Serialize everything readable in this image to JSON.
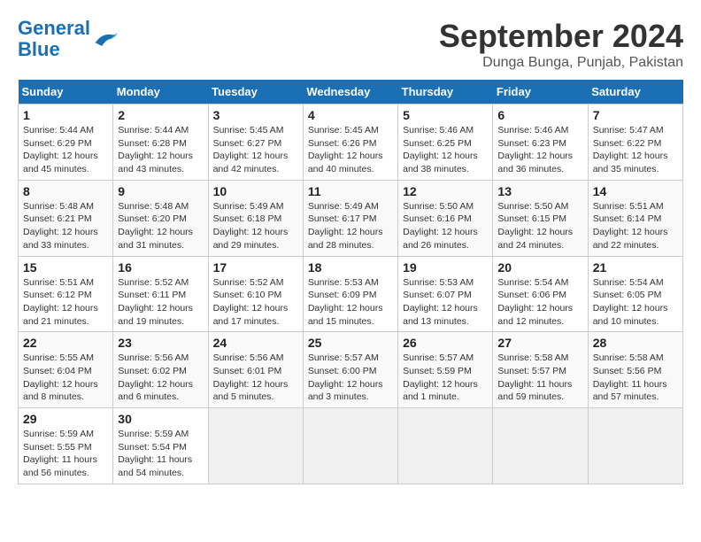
{
  "app": {
    "name": "General",
    "name_blue": "Blue"
  },
  "title": "September 2024",
  "location": "Dunga Bunga, Punjab, Pakistan",
  "weekdays": [
    "Sunday",
    "Monday",
    "Tuesday",
    "Wednesday",
    "Thursday",
    "Friday",
    "Saturday"
  ],
  "weeks": [
    [
      {
        "day": "1",
        "info": "Sunrise: 5:44 AM\nSunset: 6:29 PM\nDaylight: 12 hours\nand 45 minutes."
      },
      {
        "day": "2",
        "info": "Sunrise: 5:44 AM\nSunset: 6:28 PM\nDaylight: 12 hours\nand 43 minutes."
      },
      {
        "day": "3",
        "info": "Sunrise: 5:45 AM\nSunset: 6:27 PM\nDaylight: 12 hours\nand 42 minutes."
      },
      {
        "day": "4",
        "info": "Sunrise: 5:45 AM\nSunset: 6:26 PM\nDaylight: 12 hours\nand 40 minutes."
      },
      {
        "day": "5",
        "info": "Sunrise: 5:46 AM\nSunset: 6:25 PM\nDaylight: 12 hours\nand 38 minutes."
      },
      {
        "day": "6",
        "info": "Sunrise: 5:46 AM\nSunset: 6:23 PM\nDaylight: 12 hours\nand 36 minutes."
      },
      {
        "day": "7",
        "info": "Sunrise: 5:47 AM\nSunset: 6:22 PM\nDaylight: 12 hours\nand 35 minutes."
      }
    ],
    [
      {
        "day": "8",
        "info": "Sunrise: 5:48 AM\nSunset: 6:21 PM\nDaylight: 12 hours\nand 33 minutes."
      },
      {
        "day": "9",
        "info": "Sunrise: 5:48 AM\nSunset: 6:20 PM\nDaylight: 12 hours\nand 31 minutes."
      },
      {
        "day": "10",
        "info": "Sunrise: 5:49 AM\nSunset: 6:18 PM\nDaylight: 12 hours\nand 29 minutes."
      },
      {
        "day": "11",
        "info": "Sunrise: 5:49 AM\nSunset: 6:17 PM\nDaylight: 12 hours\nand 28 minutes."
      },
      {
        "day": "12",
        "info": "Sunrise: 5:50 AM\nSunset: 6:16 PM\nDaylight: 12 hours\nand 26 minutes."
      },
      {
        "day": "13",
        "info": "Sunrise: 5:50 AM\nSunset: 6:15 PM\nDaylight: 12 hours\nand 24 minutes."
      },
      {
        "day": "14",
        "info": "Sunrise: 5:51 AM\nSunset: 6:14 PM\nDaylight: 12 hours\nand 22 minutes."
      }
    ],
    [
      {
        "day": "15",
        "info": "Sunrise: 5:51 AM\nSunset: 6:12 PM\nDaylight: 12 hours\nand 21 minutes."
      },
      {
        "day": "16",
        "info": "Sunrise: 5:52 AM\nSunset: 6:11 PM\nDaylight: 12 hours\nand 19 minutes."
      },
      {
        "day": "17",
        "info": "Sunrise: 5:52 AM\nSunset: 6:10 PM\nDaylight: 12 hours\nand 17 minutes."
      },
      {
        "day": "18",
        "info": "Sunrise: 5:53 AM\nSunset: 6:09 PM\nDaylight: 12 hours\nand 15 minutes."
      },
      {
        "day": "19",
        "info": "Sunrise: 5:53 AM\nSunset: 6:07 PM\nDaylight: 12 hours\nand 13 minutes."
      },
      {
        "day": "20",
        "info": "Sunrise: 5:54 AM\nSunset: 6:06 PM\nDaylight: 12 hours\nand 12 minutes."
      },
      {
        "day": "21",
        "info": "Sunrise: 5:54 AM\nSunset: 6:05 PM\nDaylight: 12 hours\nand 10 minutes."
      }
    ],
    [
      {
        "day": "22",
        "info": "Sunrise: 5:55 AM\nSunset: 6:04 PM\nDaylight: 12 hours\nand 8 minutes."
      },
      {
        "day": "23",
        "info": "Sunrise: 5:56 AM\nSunset: 6:02 PM\nDaylight: 12 hours\nand 6 minutes."
      },
      {
        "day": "24",
        "info": "Sunrise: 5:56 AM\nSunset: 6:01 PM\nDaylight: 12 hours\nand 5 minutes."
      },
      {
        "day": "25",
        "info": "Sunrise: 5:57 AM\nSunset: 6:00 PM\nDaylight: 12 hours\nand 3 minutes."
      },
      {
        "day": "26",
        "info": "Sunrise: 5:57 AM\nSunset: 5:59 PM\nDaylight: 12 hours\nand 1 minute."
      },
      {
        "day": "27",
        "info": "Sunrise: 5:58 AM\nSunset: 5:57 PM\nDaylight: 11 hours\nand 59 minutes."
      },
      {
        "day": "28",
        "info": "Sunrise: 5:58 AM\nSunset: 5:56 PM\nDaylight: 11 hours\nand 57 minutes."
      }
    ],
    [
      {
        "day": "29",
        "info": "Sunrise: 5:59 AM\nSunset: 5:55 PM\nDaylight: 11 hours\nand 56 minutes."
      },
      {
        "day": "30",
        "info": "Sunrise: 5:59 AM\nSunset: 5:54 PM\nDaylight: 11 hours\nand 54 minutes."
      },
      {
        "day": "",
        "info": ""
      },
      {
        "day": "",
        "info": ""
      },
      {
        "day": "",
        "info": ""
      },
      {
        "day": "",
        "info": ""
      },
      {
        "day": "",
        "info": ""
      }
    ]
  ]
}
